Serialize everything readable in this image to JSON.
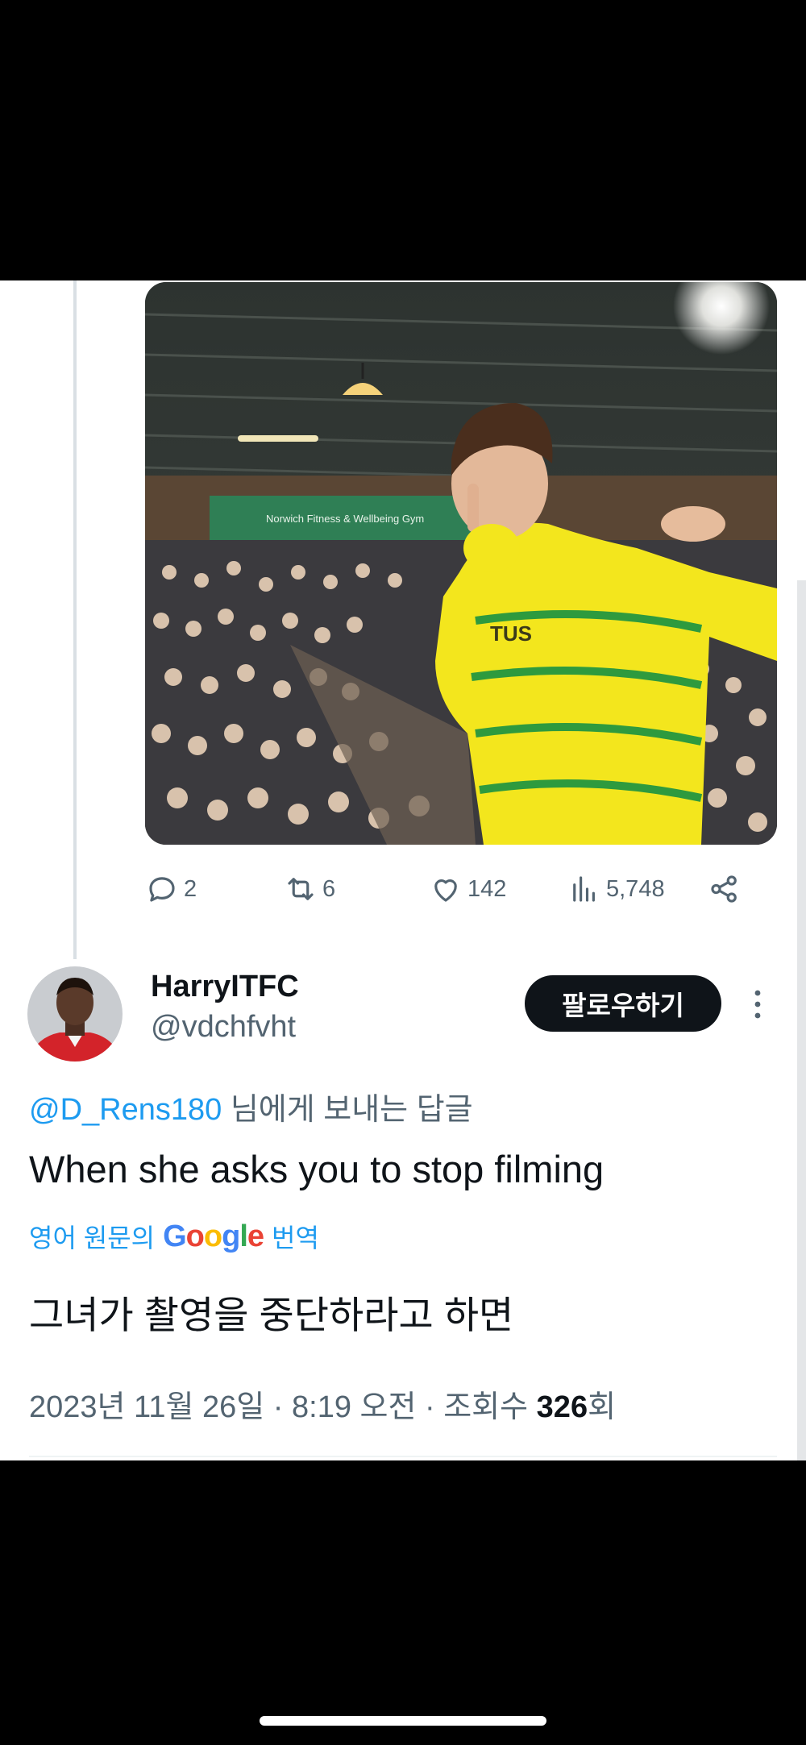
{
  "tweet_above": {
    "stats": {
      "replies": "2",
      "reposts": "6",
      "likes": "142",
      "views": "5,748"
    },
    "media": {
      "banner_text": "Norwich Fitness & Wellbeing Gym",
      "shirt_sponsor": "TUS"
    }
  },
  "tweet": {
    "display_name": "HarryITFC",
    "handle": "@vdchfvht",
    "follow_label": "팔로우하기",
    "reply_mention": "@D_Rens180",
    "reply_suffix": "님에게 보내는 답글",
    "text": "When she asks you to stop filming",
    "translate_prefix": "영어 원문의",
    "translate_brand": "Google",
    "translate_suffix": "번역",
    "translated_text": "그녀가 촬영을 중단하라고 하면",
    "timestamp": "2023년 11월 26일 · 8:19 오전 · 조회수",
    "views_count": "326",
    "views_suffix": "회"
  },
  "colors": {
    "accent": "#1d9bf0",
    "text_primary": "#0f1419",
    "text_secondary": "#536471",
    "google_blue": "#4285f4",
    "google_red": "#ea4335",
    "google_yellow": "#fbbc05",
    "google_green": "#34a853"
  },
  "icons": [
    "reply-icon",
    "repost-icon",
    "like-icon",
    "views-icon",
    "share-icon",
    "more-icon"
  ]
}
